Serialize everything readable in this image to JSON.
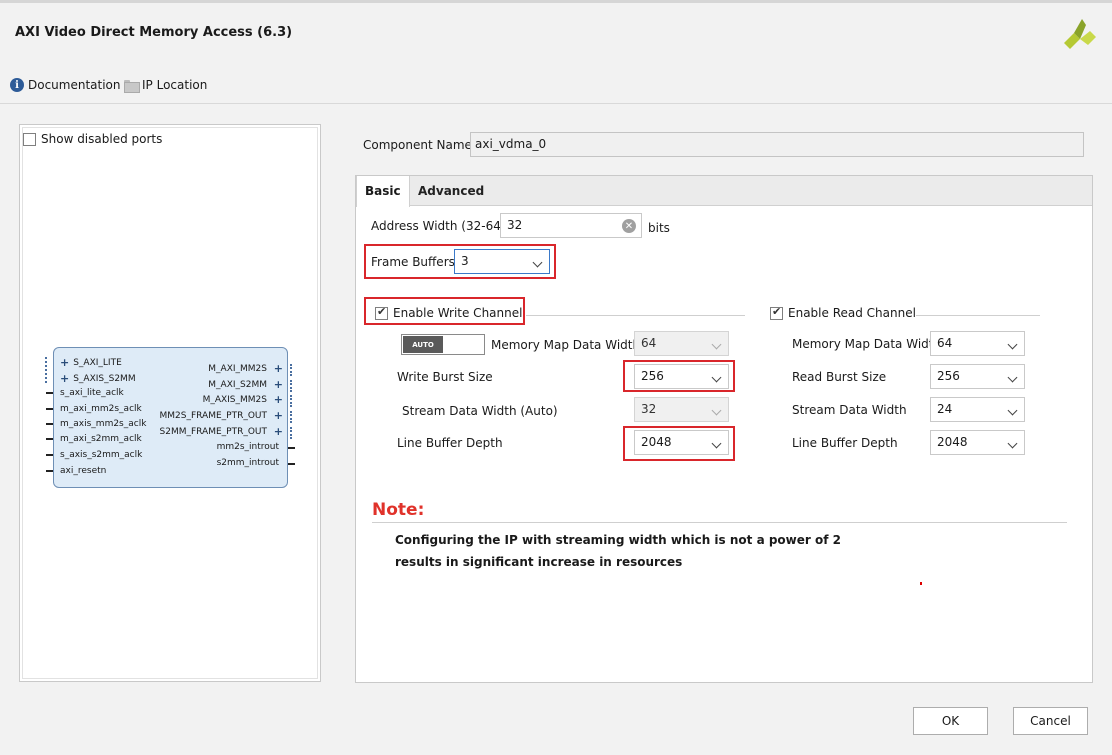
{
  "window": {
    "title": "AXI Video Direct Memory Access (6.3)"
  },
  "header_links": {
    "documentation": "Documentation",
    "ip_location": "IP Location"
  },
  "left": {
    "show_disabled_ports": "Show disabled ports",
    "ports_left": [
      "S_AXI_LITE",
      "S_AXIS_S2MM",
      "s_axi_lite_aclk",
      "m_axi_mm2s_aclk",
      "m_axis_mm2s_aclk",
      "m_axi_s2mm_aclk",
      "s_axis_s2mm_aclk",
      "axi_resetn"
    ],
    "ports_right": [
      "M_AXI_MM2S",
      "M_AXI_S2MM",
      "M_AXIS_MM2S",
      "MM2S_FRAME_PTR_OUT",
      "S2MM_FRAME_PTR_OUT",
      "mm2s_introut",
      "s2mm_introut"
    ]
  },
  "component": {
    "label": "Component Name",
    "value": "axi_vdma_0"
  },
  "tabs": [
    "Basic",
    "Advanced"
  ],
  "basic": {
    "address_width_label": "Address Width (32-64)",
    "address_width_value": "32",
    "address_width_unit": "bits",
    "frame_buffers_label": "Frame Buffers",
    "frame_buffers_value": "3",
    "write": {
      "enable_label": "Enable Write Channel",
      "toggle_label": "AUTO",
      "mm_data_width_label": "Memory Map Data Width",
      "mm_data_width_value": "64",
      "burst_size_label": "Write Burst Size",
      "burst_size_value": "256",
      "stream_width_label": "Stream Data Width (Auto)",
      "stream_width_value": "32",
      "line_buffer_label": "Line Buffer Depth",
      "line_buffer_value": "2048"
    },
    "read": {
      "enable_label": "Enable Read Channel",
      "mm_data_width_label": "Memory Map Data Width",
      "mm_data_width_value": "64",
      "burst_size_label": "Read Burst Size",
      "burst_size_value": "256",
      "stream_width_label": "Stream Data Width",
      "stream_width_value": "24",
      "line_buffer_label": "Line Buffer Depth",
      "line_buffer_value": "2048"
    },
    "note_title": "Note:",
    "note_line1": "Configuring the IP with streaming width which is not a power of 2",
    "note_line2": "results in significant increase in resources"
  },
  "buttons": {
    "ok": "OK",
    "cancel": "Cancel"
  },
  "colors": {
    "highlight_red": "#d9262b",
    "note_red": "#e0322a",
    "ip_block_fill": "#deebf7",
    "info_blue": "#2d5b98"
  }
}
